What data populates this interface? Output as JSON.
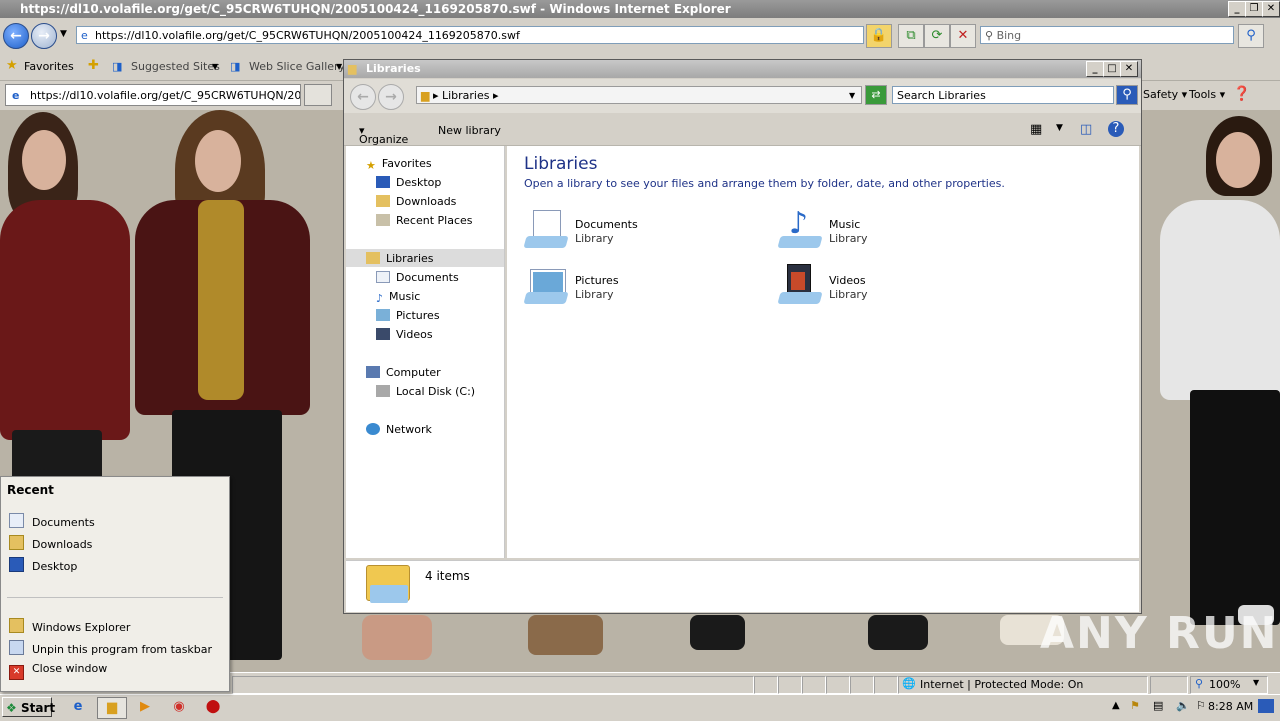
{
  "ie": {
    "title": "https://dl10.volafile.org/get/C_95CRW6TUHQN/2005100424_1169205870.swf - Windows Internet Explorer",
    "address": "https://dl10.volafile.org/get/C_95CRW6TUHQN/2005100424_1169205870.swf",
    "search_placeholder": "Bing",
    "favorites_label": "Favorites",
    "suggested_sites": "Suggested Sites",
    "web_slice_gallery": "Web Slice Gallery",
    "tab_title": "https://dl10.volafile.org/get/C_95CRW6TUHQN/2005...",
    "safety": "Safety",
    "tools": "Tools",
    "status_zone": "Internet | Protected Mode: On",
    "zoom": "100%"
  },
  "explorer": {
    "title": "Libraries",
    "breadcrumb": "Libraries",
    "search_placeholder": "Search Libraries",
    "organize": "Organize",
    "new_library": "New library",
    "heading": "Libraries",
    "subheading": "Open a library to see your files and arrange them by folder, date, and other properties.",
    "nav": {
      "favorites": "Favorites",
      "desktop": "Desktop",
      "downloads": "Downloads",
      "recent_places": "Recent Places",
      "libraries": "Libraries",
      "documents": "Documents",
      "music": "Music",
      "pictures": "Pictures",
      "videos": "Videos",
      "computer": "Computer",
      "local_disk": "Local Disk (C:)",
      "network": "Network"
    },
    "libraries": [
      {
        "name": "Documents",
        "type": "Library"
      },
      {
        "name": "Music",
        "type": "Library"
      },
      {
        "name": "Pictures",
        "type": "Library"
      },
      {
        "name": "Videos",
        "type": "Library"
      }
    ],
    "item_count": "4 items"
  },
  "jumplist": {
    "header": "Recent",
    "recent": [
      "Documents",
      "Downloads",
      "Desktop"
    ],
    "tasks": [
      "Windows Explorer",
      "Unpin this program from taskbar",
      "Close window"
    ]
  },
  "taskbar": {
    "start": "Start",
    "clock": "8:28 AM"
  },
  "watermark": "ANY RUN"
}
